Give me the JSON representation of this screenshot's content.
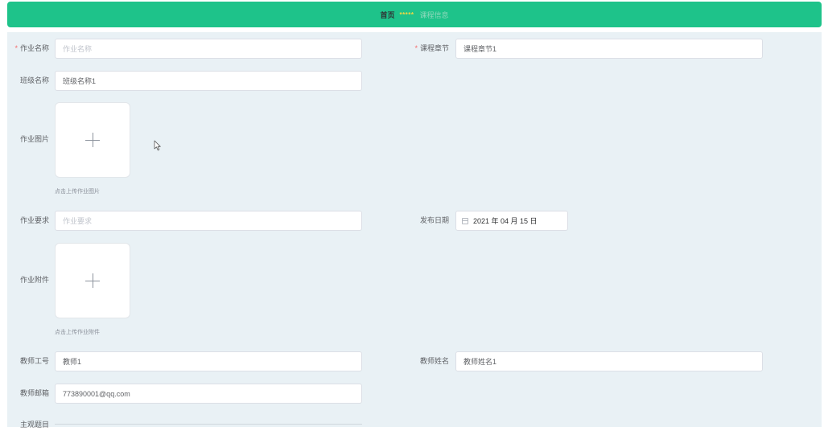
{
  "breadcrumb": {
    "home": "首页",
    "separator": "*****",
    "current": "课程信息"
  },
  "form": {
    "homework_name": {
      "label": "作业名称",
      "placeholder": "作业名称",
      "value": "",
      "required": true
    },
    "course_chapter": {
      "label": "课程章节",
      "value": "课程章节1",
      "required": true
    },
    "class_name": {
      "label": "班级名称",
      "value": "班级名称1"
    },
    "homework_image": {
      "label": "作业图片",
      "tip": "点击上传作业图片"
    },
    "homework_requirement": {
      "label": "作业要求",
      "placeholder": "作业要求",
      "value": ""
    },
    "publish_date": {
      "label": "发布日期",
      "value": "2021 年 04 月 15 日"
    },
    "homework_attachment": {
      "label": "作业附件",
      "tip": "点击上传作业附件"
    },
    "teacher_id": {
      "label": "教师工号",
      "value": "教师1"
    },
    "teacher_name": {
      "label": "教师姓名",
      "value": "教师姓名1"
    },
    "teacher_email": {
      "label": "教师邮箱",
      "value": "773890001@qq.com"
    },
    "subjective_questions": {
      "label": "主观题目"
    }
  },
  "colors": {
    "header": "#1ec38a",
    "panel": "#e9f1f5",
    "required": "#f56c6c"
  },
  "icons": [
    "plus-icon",
    "calendar-icon",
    "mouse-cursor-icon"
  ]
}
